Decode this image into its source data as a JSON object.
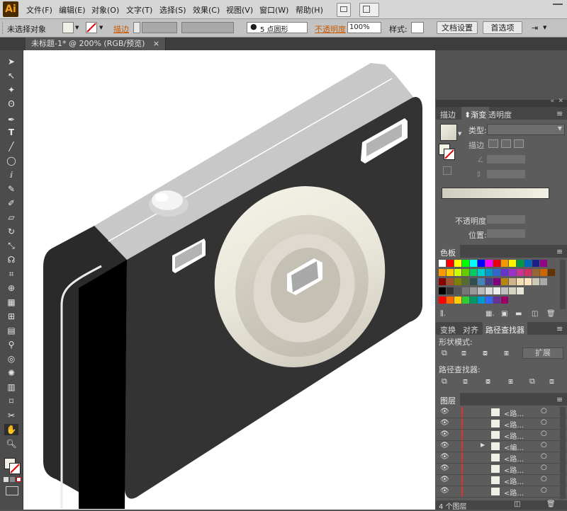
{
  "app": {
    "logo": "Ai",
    "brand_color": "#f7a31a"
  },
  "menu": [
    "文件(F)",
    "编辑(E)",
    "对象(O)",
    "文字(T)",
    "选择(S)",
    "效果(C)",
    "视图(V)",
    "窗口(W)",
    "帮助(H)"
  ],
  "control_bar": {
    "selection_status": "未选择对象",
    "stroke_label": "描边",
    "brush_value": "5 点圆形",
    "opacity_label": "不透明度",
    "opacity_value": "100%",
    "style_label": "样式:",
    "doc_settings": "文档设置",
    "preferences": "首选项"
  },
  "document_tab": {
    "title": "未标题-1* @ 200% (RGB/预览)",
    "close": "×"
  },
  "panels": {
    "gradient": {
      "tabs": [
        "描边",
        "渐变",
        "透明度"
      ],
      "type_label": "类型:",
      "stroke_label": "描边",
      "opacity_label": "不透明度:",
      "position_label": "位置:",
      "gradient_colors": [
        "#cfccc0",
        "#f3f0e4"
      ]
    },
    "swatches": {
      "tab": "色板",
      "row1": [
        "#ffffff",
        "#ff0000",
        "#ffff00",
        "#00ff00",
        "#00ffff",
        "#0000ff",
        "#ff00ff",
        "#e60012",
        "#f39800",
        "#fff100",
        "#009944",
        "#0068b7",
        "#1d2088",
        "#920783"
      ],
      "row2": [
        "#ff9900",
        "#ffcc00",
        "#ccff00",
        "#66cc00",
        "#00cc66",
        "#00cccc",
        "#0099cc",
        "#3366cc",
        "#6633cc",
        "#9933cc",
        "#cc3399",
        "#cc3366",
        "#996633",
        "#cc6600",
        "#663300"
      ],
      "row3": [
        "#8b0000",
        "#a0522d",
        "#808000",
        "#556b2f",
        "#2f4f4f",
        "#4682b4",
        "#483d8b",
        "#800080",
        "#b8860b",
        "#d2b48c",
        "#f5deb3",
        "#ffe4c4",
        "#cdc9b5",
        "#a9a9a9"
      ],
      "row4": [
        "#000000",
        "#333333",
        "#555555",
        "#777777",
        "#999999",
        "#bbbbbb",
        "#dddddd",
        "#eeeeee",
        "#c0c0c0",
        "#d8d4c4",
        "#e8e4d8"
      ],
      "row5": [
        "#ff0000",
        "#ff6600",
        "#ffcc00",
        "#33cc33",
        "#009966",
        "#0099cc",
        "#3366ff",
        "#663399",
        "#990066"
      ]
    },
    "pathfinder": {
      "tabs": [
        "变换",
        "对齐",
        "路径查找器"
      ],
      "shape_modes_label": "形状模式:",
      "expand_button": "扩展",
      "pathfinders_label": "路径查找器:"
    },
    "layers": {
      "tab": "图层",
      "rows": [
        "<路...",
        "<路...",
        "<路...",
        "<编...",
        "<路...",
        "<路...",
        "<路...",
        "<路..."
      ],
      "footer": "4 个图层"
    }
  }
}
